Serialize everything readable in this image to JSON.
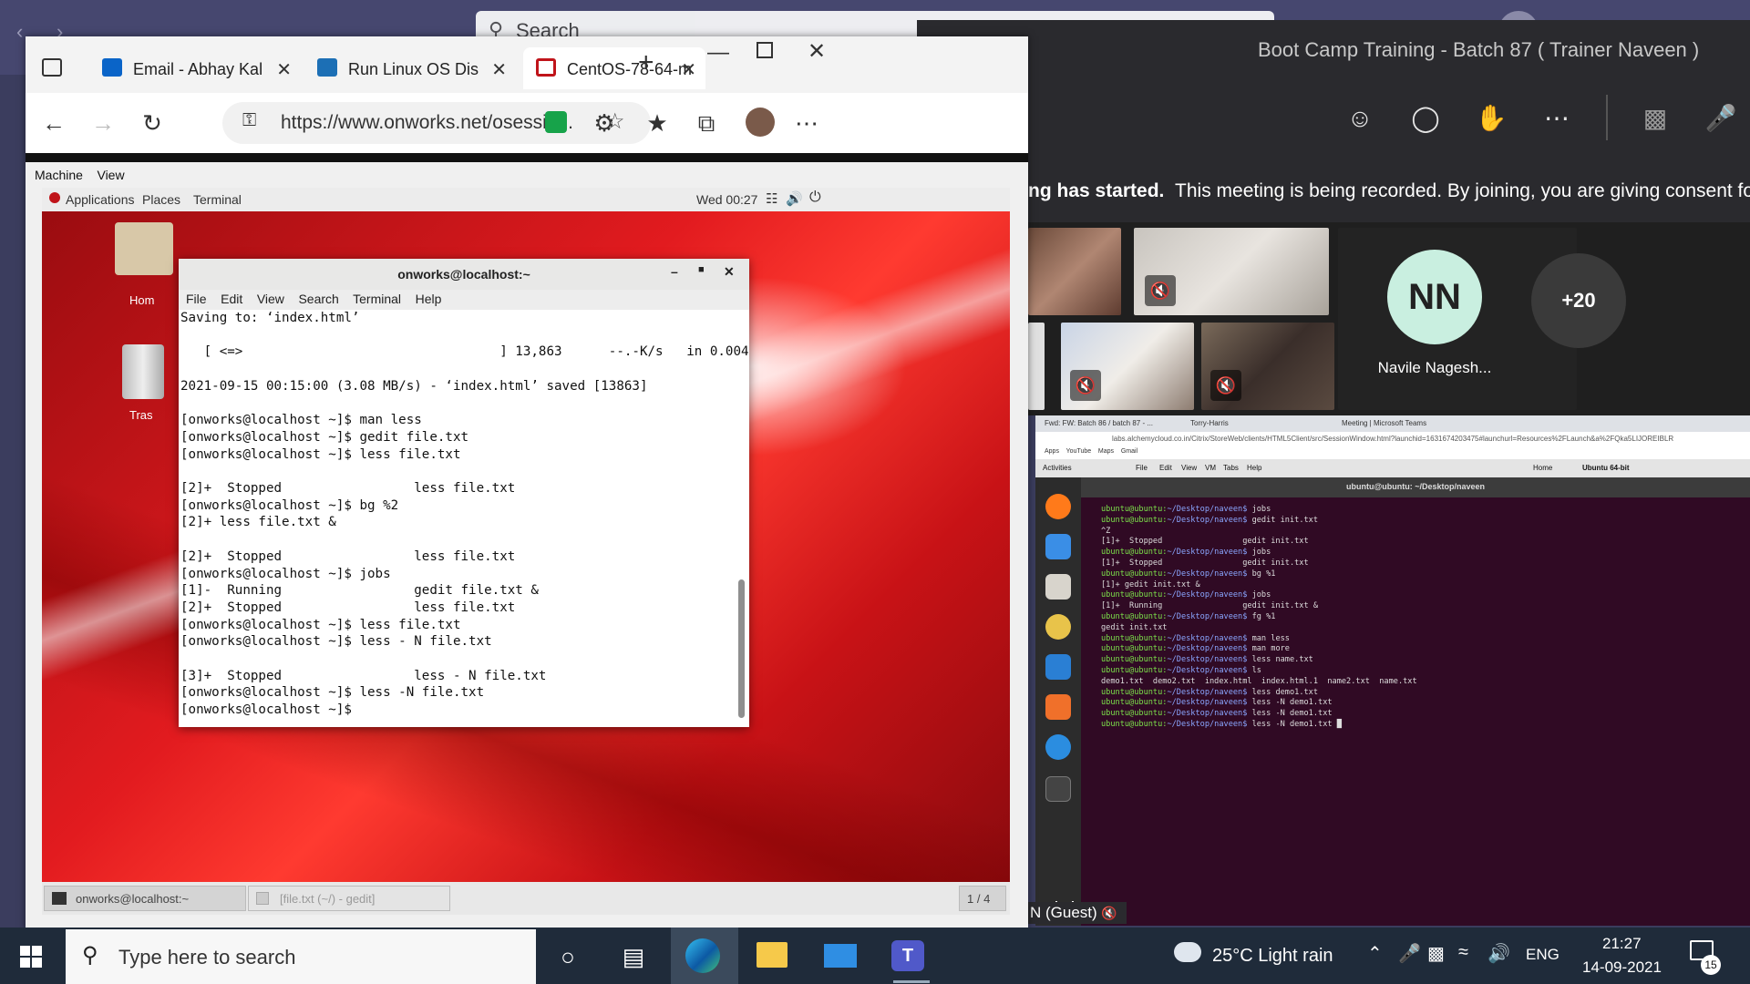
{
  "teams": {
    "search_placeholder": "Search",
    "meeting_title": "Boot Camp Training - Batch 87 ( Trainer Naveen )",
    "notice_bold": "ng has started.",
    "notice_text": "This meeting is being recorded. By joining, you are giving consent fo",
    "avatar_initials": "NN",
    "avatar_name": "Navile Nagesh...",
    "more_participants": "+20",
    "guest_label": "N (Guest)"
  },
  "shared_screen": {
    "tabs": [
      "Fwd: FW: Batch 86 / batch 87 - ...",
      "Torry-Harris",
      "Meeting | Microsoft Teams"
    ],
    "url": "labs.alchemycloud.co.in/Citrix/StoreWeb/clients/HTML5Client/src/SessionWindow.html?launchid=1631674203475#launchurl=Resources%2FLaunch&a%2FQka5LIJOREIBLR",
    "bookmarks": [
      "Apps",
      "YouTube",
      "Maps",
      "Gmail"
    ],
    "activities": "Activities",
    "vm_menu": [
      "File",
      "Edit",
      "View",
      "VM",
      "Tabs",
      "Help"
    ],
    "vm_tabs": [
      "Home",
      "Ubuntu 64-bit"
    ],
    "terminal_title": "ubuntu@ubuntu: ~/Desktop/naveen",
    "prompt": "ubuntu@ubuntu:",
    "path": "~/Desktop/naveen$",
    "lines": [
      {
        "p": true,
        "t": " jobs"
      },
      {
        "p": true,
        "t": " gedit init.txt"
      },
      {
        "p": false,
        "t": "^Z"
      },
      {
        "p": false,
        "t": "[1]+  Stopped                 gedit init.txt"
      },
      {
        "p": true,
        "t": " jobs"
      },
      {
        "p": false,
        "t": "[1]+  Stopped                 gedit init.txt"
      },
      {
        "p": true,
        "t": " bg %1"
      },
      {
        "p": false,
        "t": "[1]+ gedit init.txt &"
      },
      {
        "p": true,
        "t": " jobs"
      },
      {
        "p": false,
        "t": "[1]+  Running                 gedit init.txt &"
      },
      {
        "p": true,
        "t": " fg %1"
      },
      {
        "p": false,
        "t": "gedit init.txt"
      },
      {
        "p": true,
        "t": " man less"
      },
      {
        "p": true,
        "t": " man more"
      },
      {
        "p": true,
        "t": " less name.txt"
      },
      {
        "p": true,
        "t": " ls"
      },
      {
        "p": false,
        "t": "demo1.txt  demo2.txt  index.html  index.html.1  name2.txt  name.txt"
      },
      {
        "p": true,
        "t": " less demo1.txt"
      },
      {
        "p": true,
        "t": " less -N demo1.txt"
      },
      {
        "p": true,
        "t": " less -N demo1.txt"
      },
      {
        "p": true,
        "t": " less -N demo1.txt █"
      }
    ]
  },
  "browser": {
    "tabs": [
      {
        "label": "Email - Abhay Kal",
        "color": "#0a64c8"
      },
      {
        "label": "Run Linux OS Dis",
        "color": "#1c6fb5"
      },
      {
        "label": "CentOS-78-64-m",
        "color": "#c0141a"
      }
    ],
    "url": "https://www.onworks.net/osessio...",
    "vm_menu": [
      "Machine",
      "View"
    ]
  },
  "gnome": {
    "menus": [
      "Applications",
      "Places",
      "Terminal"
    ],
    "clock": "Wed 00:27",
    "desktop_icons": [
      "Hom",
      "Tras"
    ],
    "taskbar_items": [
      "onworks@localhost:~",
      "[file.txt (~/) - gedit]"
    ],
    "workspace": "1 / 4"
  },
  "terminal": {
    "title": "onworks@localhost:~",
    "menu": [
      "File",
      "Edit",
      "View",
      "Search",
      "Terminal",
      "Help"
    ],
    "output": "Saving to: ‘index.html’\n\n   [ <=>                                 ] 13,863      --.-K/s   in 0.004s\n\n2021-09-15 00:15:00 (3.08 MB/s) - ‘index.html’ saved [13863]\n\n[onworks@localhost ~]$ man less\n[onworks@localhost ~]$ gedit file.txt\n[onworks@localhost ~]$ less file.txt\n\n[2]+  Stopped                 less file.txt\n[onworks@localhost ~]$ bg %2\n[2]+ less file.txt &\n\n[2]+  Stopped                 less file.txt\n[onworks@localhost ~]$ jobs\n[1]-  Running                 gedit file.txt &\n[2]+  Stopped                 less file.txt\n[onworks@localhost ~]$ less file.txt\n[onworks@localhost ~]$ less - N file.txt\n\n[3]+  Stopped                 less - N file.txt\n[onworks@localhost ~]$ less -N file.txt\n[onworks@localhost ~]$ "
  },
  "taskbar": {
    "search_placeholder": "Type here to search",
    "weather": "25°C  Light rain",
    "language": "ENG",
    "time": "21:27",
    "date": "14-09-2021",
    "notifications": "15"
  }
}
